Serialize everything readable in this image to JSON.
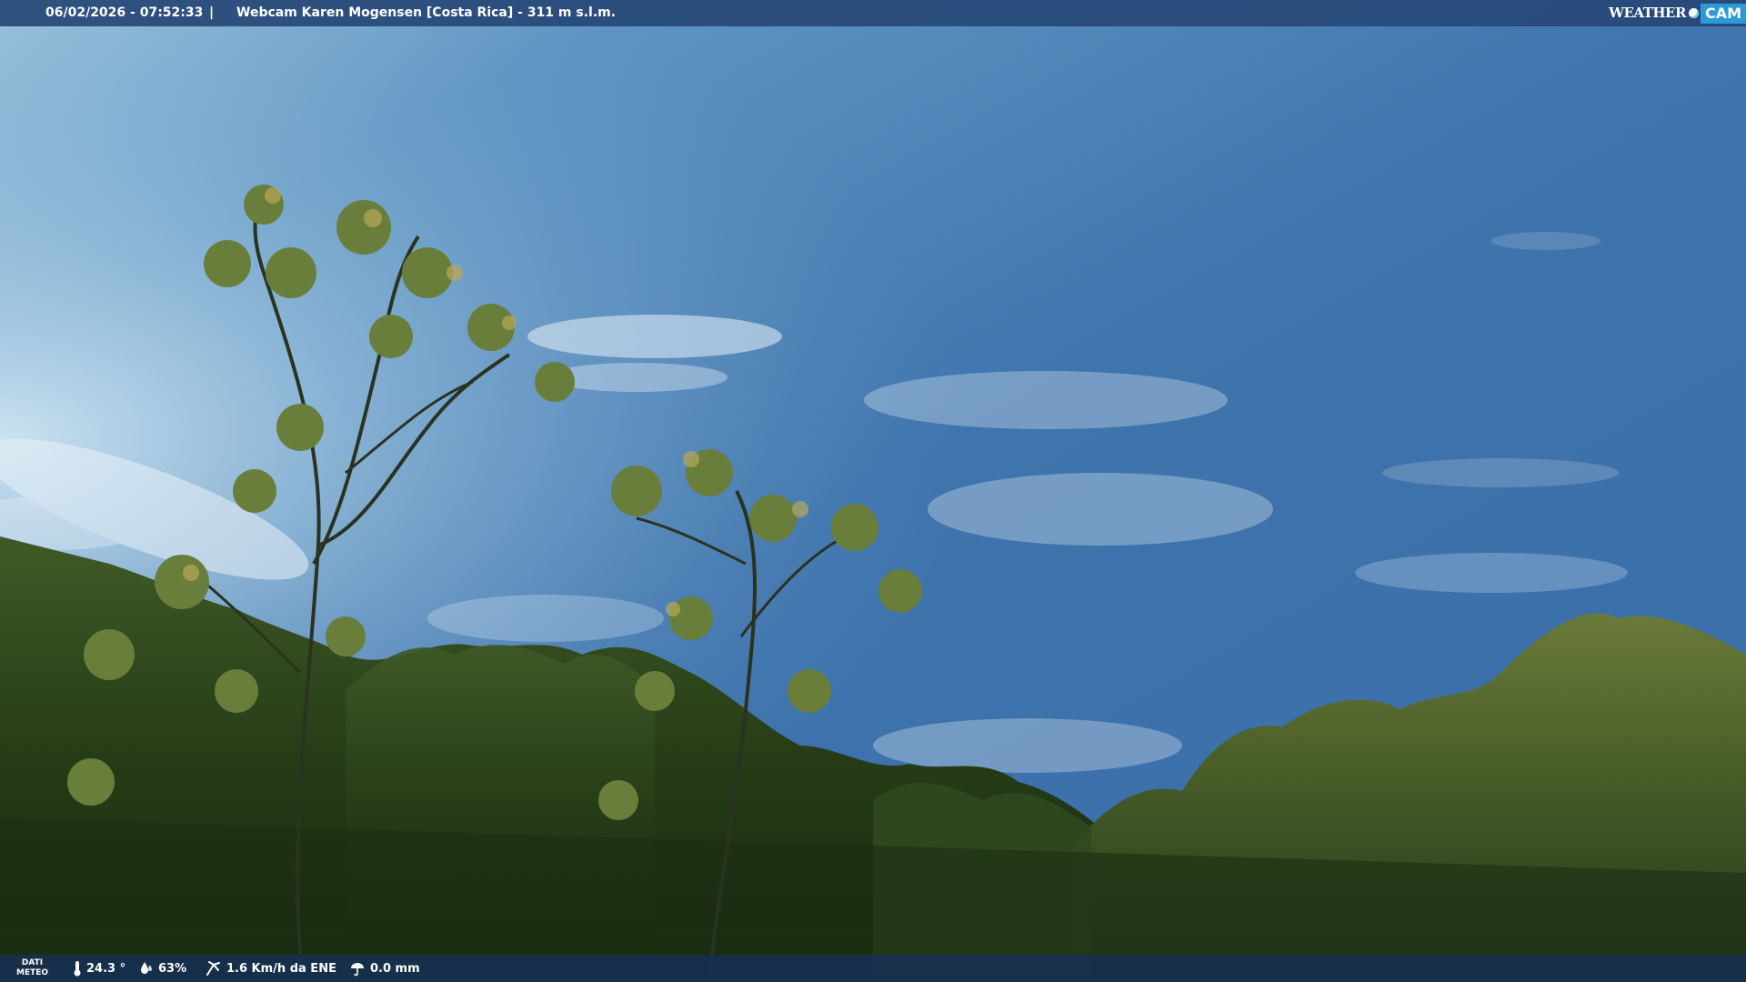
{
  "top_bar": {
    "datetime": "06/02/2026 - 07:52:33",
    "separator": "|",
    "title": "Webcam Karen Mogensen [Costa Rica]  - 311 m s.l.m."
  },
  "logo": {
    "weather_text": "WEATHER",
    "cam_text": "CAM"
  },
  "weather_bar": {
    "label_line1": "DATI",
    "label_line2": "METEO",
    "temperature": "24.3 °",
    "humidity": "63%",
    "wind": "1.6 Km/h da ENE",
    "rain": "0.0 mm"
  },
  "icons": [
    "thermometer-icon",
    "humidity-icon",
    "wind-icon",
    "rain-icon"
  ],
  "colors": {
    "bar_top": "#264876",
    "bar_bottom": "#163052",
    "logo_accent": "#2c9ad6"
  }
}
